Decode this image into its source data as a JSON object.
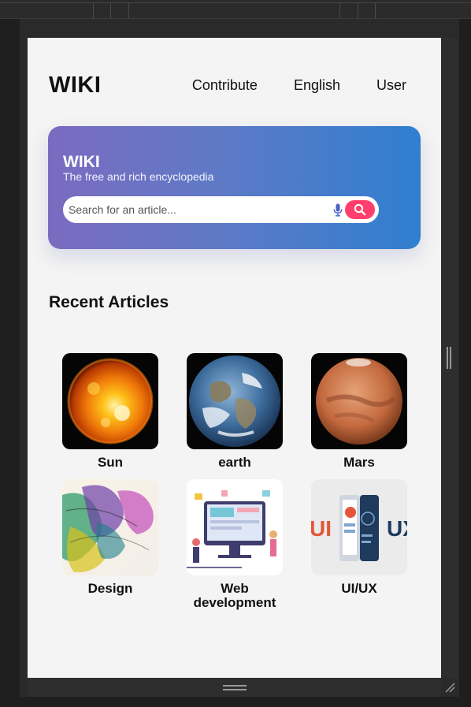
{
  "nav": {
    "logo": "WIKI",
    "links": [
      "Contribute",
      "English",
      "User"
    ]
  },
  "hero": {
    "title": "WIKI",
    "subtitle": "The free and rich encyclopedia",
    "search_placeholder": "Search for an article..."
  },
  "recent": {
    "title": "Recent Articles",
    "items": [
      {
        "label": "Sun",
        "icon": "sun-image"
      },
      {
        "label": "earth",
        "icon": "earth-image"
      },
      {
        "label": "Mars",
        "icon": "mars-image"
      },
      {
        "label": "Design",
        "icon": "design-image"
      },
      {
        "label": "Web development",
        "icon": "web-development-image"
      },
      {
        "label": "UI/UX",
        "icon": "ui-ux-image"
      }
    ]
  },
  "colors": {
    "hero_gradient_start": "#7b6bc0",
    "hero_gradient_end": "#2f7fd0",
    "search_button": "#ff3e6c",
    "page_background": "#f4f4f4"
  }
}
